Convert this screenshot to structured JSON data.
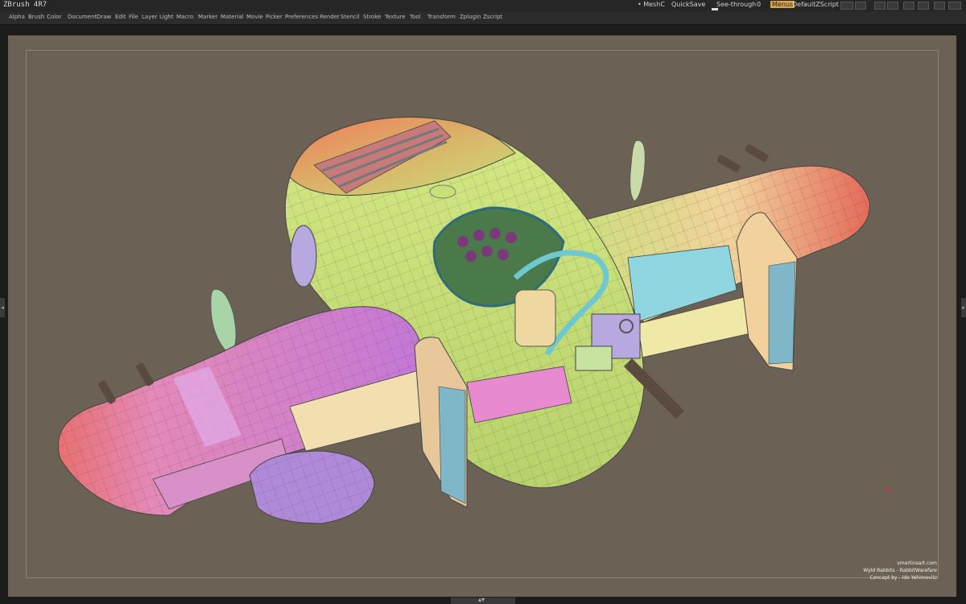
{
  "titlebar": {
    "app_title": "ZBrush 4R7",
    "mesh_label": "• MeshC",
    "quicksave": "QuickSave",
    "see_through_label": "See-through",
    "see_through_value": "0",
    "menus": "Menus",
    "script": "DefaultZScript"
  },
  "menus": [
    "Alpha",
    "Brush",
    "Color",
    "Document",
    "Draw",
    "Edit",
    "File",
    "Layer",
    "Light",
    "Macro",
    "Marker",
    "Material",
    "Movie",
    "Picker",
    "Preferences",
    "Render",
    "Stencil",
    "Stroke",
    "Texture",
    "Tool",
    "Transform",
    "Zplugin",
    "Zscript"
  ],
  "credits": {
    "site": "vmartinsart.com",
    "project": "Wyld Rabbits - RabbitWarefare",
    "concept": "Concept by - Ido Yehimovitz"
  },
  "colors": {
    "canvas": "#6b6255",
    "wing_pink": "#d27adc",
    "body_green": "#c9e27a",
    "nose_red": "#e56a5a",
    "cockpit_cyan": "#6fd0d8"
  }
}
